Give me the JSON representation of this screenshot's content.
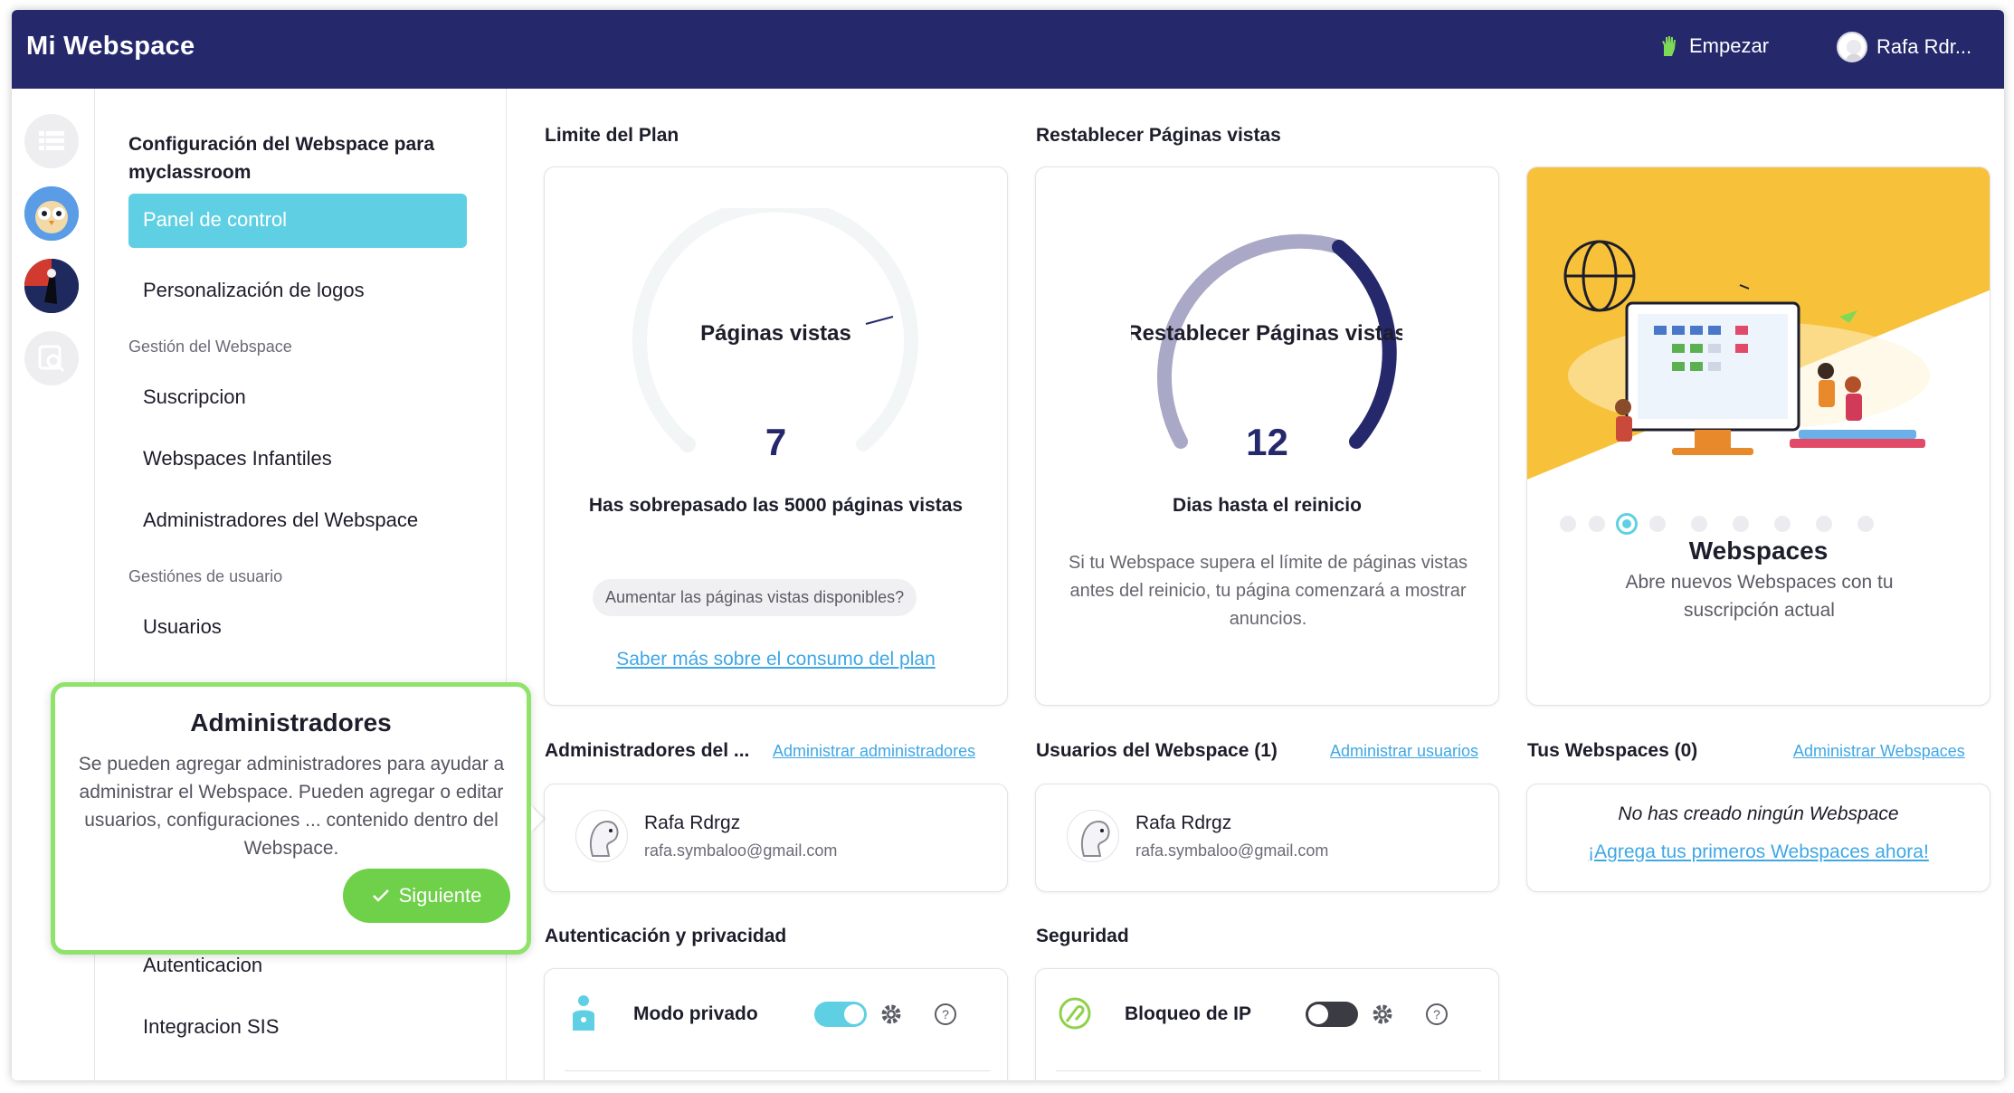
{
  "app": {
    "title": "Mi Webspace",
    "start_label": "Empezar",
    "user_label": "Rafa Rdr..."
  },
  "sidebar": {
    "title": "Configuración del Webspace para myclassroom",
    "items": [
      {
        "label": "Panel de control",
        "active": true
      },
      {
        "label": "Personalización de logos"
      }
    ],
    "group1": "Gestión del Webspace",
    "group1_items": [
      "Suscripcion",
      "Webspaces Infantiles",
      "Administradores del Webspace"
    ],
    "group2": "Gestiónes de usuario",
    "group2_items": [
      "Usuarios"
    ],
    "bottom_items": [
      "Autenticacion",
      "Integracion SIS"
    ]
  },
  "plan": {
    "section_title": "Limite del Plan",
    "gauge_label": "Páginas vistas",
    "gauge_value": "7",
    "message": "Has sobrepasado las 5000 páginas vistas",
    "increase_pill": "Aumentar las páginas vistas disponibles?",
    "learn_more": "Saber más sobre el consumo del plan"
  },
  "reset": {
    "section_title": "Restablecer Páginas vistas",
    "gauge_label": "Restablecer Páginas vistas",
    "gauge_value": "12",
    "subtitle": "Dias hasta el reinicio",
    "description": "Si tu Webspace supera el límite de páginas vistas antes del reinicio, tu página comenzará a mostrar anuncios."
  },
  "promo": {
    "title": "Webspaces",
    "description": "Abre nuevos Webspaces con tu suscripción actual",
    "dots": 9,
    "active_dot": 2
  },
  "admins": {
    "section_title": "Administradores del ...",
    "manage_link": "Administrar administradores",
    "user_name": "Rafa Rdrgz",
    "user_email": "rafa.symbaloo@gmail.com"
  },
  "users": {
    "section_title": "Usuarios del Webspace (1)",
    "manage_link": "Administrar usuarios",
    "user_name": "Rafa Rdrgz",
    "user_email": "rafa.symbaloo@gmail.com"
  },
  "webspaces": {
    "section_title": "Tus Webspaces (0)",
    "manage_link": "Administrar Webspaces",
    "empty_text": "No has creado ningún Webspace",
    "add_link": "¡Agrega tus primeros Webspaces ahora!"
  },
  "auth": {
    "section_title": "Autenticación y privacidad",
    "label": "Modo privado",
    "enabled": true
  },
  "security": {
    "section_title": "Seguridad",
    "label": "Bloqueo de IP",
    "enabled": false
  },
  "tour": {
    "title": "Administradores",
    "body": "Se pueden agregar administradores para ayudar a administrar el Webspace. Pueden agregar o editar usuarios, configuraciones ... contenido dentro del Webspace.",
    "next_label": "Siguiente"
  },
  "colors": {
    "topbar": "#25286b",
    "accent": "#5fd0e3",
    "tour_border": "#8fe36a",
    "tour_button": "#6fd04a",
    "gauge_dark": "#25286b",
    "gauge_light": "#a9a8c6",
    "promo_yellow": "#f7c23a"
  }
}
